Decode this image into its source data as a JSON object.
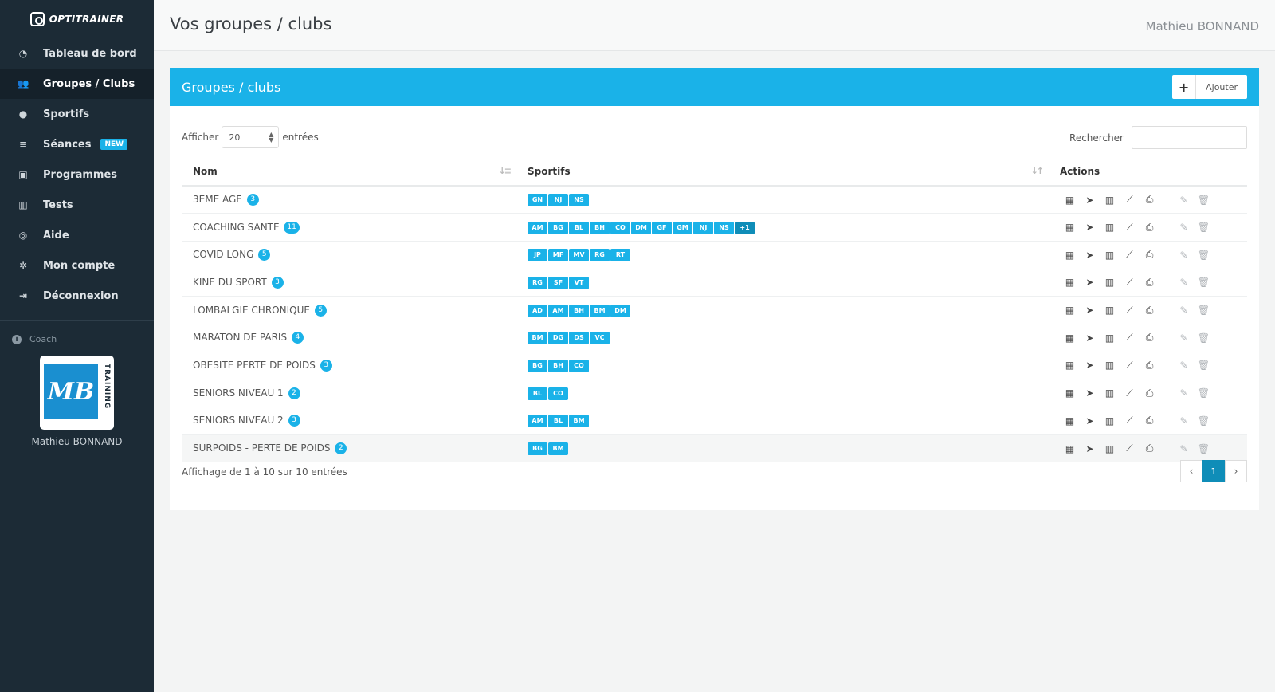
{
  "brand": "OPTITRAINER",
  "sidebar": {
    "items": [
      {
        "label": "Tableau de bord",
        "icon": "dashboard-icon",
        "glyph": "◔"
      },
      {
        "label": "Groupes / Clubs",
        "icon": "users-icon",
        "glyph": "👥"
      },
      {
        "label": "Sportifs",
        "icon": "user-icon",
        "glyph": "●"
      },
      {
        "label": "Séances",
        "icon": "database-icon",
        "glyph": "≡",
        "badge": "NEW"
      },
      {
        "label": "Programmes",
        "icon": "files-icon",
        "glyph": "▣"
      },
      {
        "label": "Tests",
        "icon": "bar-chart-icon",
        "glyph": "▥"
      },
      {
        "label": "Aide",
        "icon": "lifebuoy-icon",
        "glyph": "◎"
      },
      {
        "label": "Mon compte",
        "icon": "gear-icon",
        "glyph": "✲"
      },
      {
        "label": "Déconnexion",
        "icon": "sign-out-icon",
        "glyph": "⇥"
      }
    ],
    "coach_label": "Coach",
    "logo_text": "MB",
    "logo_side": "TRAINING",
    "coach_name": "Mathieu BONNAND"
  },
  "header": {
    "title": "Vos groupes / clubs",
    "user": "Mathieu BONNAND"
  },
  "panel": {
    "title": "Groupes / clubs",
    "add_label": "Ajouter",
    "show_label": "Afficher",
    "page_size": "20",
    "entries_label": "entrées",
    "search_label": "Rechercher",
    "columns": [
      "Nom",
      "Sportifs",
      "Actions"
    ],
    "rows": [
      {
        "name": "3EME AGE",
        "count": "3",
        "tags": [
          "GN",
          "NJ",
          "NS"
        ]
      },
      {
        "name": "COACHING SANTE",
        "count": "11",
        "tags": [
          "AM",
          "BG",
          "BL",
          "BH",
          "CO",
          "DM",
          "GF",
          "GM",
          "NJ",
          "NS"
        ],
        "more": "+1"
      },
      {
        "name": "COVID LONG",
        "count": "5",
        "tags": [
          "JP",
          "MF",
          "MV",
          "RG",
          "RT"
        ]
      },
      {
        "name": "KINE DU SPORT",
        "count": "3",
        "tags": [
          "RG",
          "SF",
          "VT"
        ]
      },
      {
        "name": "LOMBALGIE CHRONIQUE",
        "count": "5",
        "tags": [
          "AD",
          "AM",
          "BH",
          "BM",
          "DM"
        ]
      },
      {
        "name": "MARATON DE PARIS",
        "count": "4",
        "tags": [
          "BM",
          "DG",
          "DS",
          "VC"
        ]
      },
      {
        "name": "OBESITE PERTE DE POIDS",
        "count": "3",
        "tags": [
          "BG",
          "BH",
          "CO"
        ]
      },
      {
        "name": "SENIORS NIVEAU 1",
        "count": "2",
        "tags": [
          "BL",
          "CO"
        ]
      },
      {
        "name": "SENIORS NIVEAU 2",
        "count": "3",
        "tags": [
          "AM",
          "BL",
          "BM"
        ]
      },
      {
        "name": "SURPOIDS - PERTE DE POIDS",
        "count": "2",
        "tags": [
          "BG",
          "BM"
        ]
      }
    ],
    "footer_info": "Affichage de 1 à 10 sur 10 entrées",
    "current_page": "1"
  },
  "colors": {
    "accent": "#1ab2e8",
    "sidebar": "#1c2b36",
    "active_page": "#0f8db8"
  }
}
